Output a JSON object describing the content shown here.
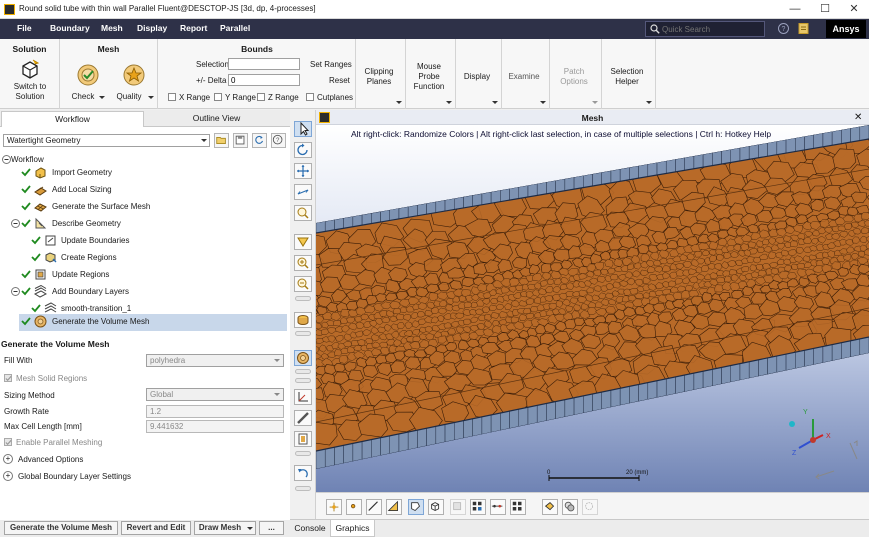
{
  "window": {
    "title": "Round solid tube with thin wall Parallel Fluent@DESCTOP-JS  [3d, dp, 4-processes]",
    "minimize": "—",
    "maximize": "☐",
    "close": "✕"
  },
  "menubar": {
    "items": [
      "File",
      "Boundary",
      "Mesh",
      "Display",
      "Report",
      "Parallel"
    ],
    "search_placeholder": "Quick Search",
    "brand": "Ansys"
  },
  "ribbon": {
    "solution": {
      "title": "Solution",
      "switch_label_1": "Switch to",
      "switch_label_2": "Solution"
    },
    "mesh": {
      "title": "Mesh",
      "check": "Check",
      "quality": "Quality"
    },
    "bounds": {
      "title": "Bounds",
      "selection_label": "Selection",
      "selection_value": "",
      "delta_label": "+/- Delta",
      "delta_value": "0",
      "set_ranges": "Set Ranges",
      "reset": "Reset",
      "x_range": "X Range",
      "y_range": "Y Range",
      "z_range": "Z Range",
      "cutplanes": "Cutplanes"
    },
    "clipping": {
      "l1": "Clipping",
      "l2": "Planes"
    },
    "probe": {
      "l1": "Mouse",
      "l2": "Probe",
      "l3": "Function"
    },
    "display": "Display",
    "examine": "Examine",
    "patch": {
      "l1": "Patch",
      "l2": "Options"
    },
    "selection": {
      "l1": "Selection",
      "l2": "Helper"
    }
  },
  "left_panel": {
    "tabs": [
      "Workflow",
      "Outline View"
    ],
    "workflow_type": "Watertight Geometry",
    "tree": {
      "root": "Workflow",
      "items": [
        {
          "label": "Import Geometry"
        },
        {
          "label": "Add Local Sizing"
        },
        {
          "label": "Generate the Surface Mesh"
        },
        {
          "label": "Describe Geometry"
        },
        {
          "label": "Update Boundaries"
        },
        {
          "label": "Create Regions"
        },
        {
          "label": "Update Regions"
        },
        {
          "label": "Add Boundary Layers"
        },
        {
          "label": "smooth-transition_1"
        },
        {
          "label": "Generate the Volume Mesh"
        }
      ]
    },
    "task": {
      "title": "Generate the Volume Mesh",
      "fill_with_label": "Fill With",
      "fill_with_value": "polyhedra",
      "mesh_solid_regions": "Mesh Solid Regions",
      "sizing_method_label": "Sizing Method",
      "sizing_method_value": "Global",
      "growth_rate_label": "Growth Rate",
      "growth_rate_value": "1.2",
      "max_cell_label": "Max Cell Length [mm]",
      "max_cell_value": "9.441632",
      "parallel_meshing": "Enable Parallel Meshing",
      "advanced": "Advanced Options",
      "global_bl": "Global Boundary Layer Settings"
    },
    "buttons": {
      "generate": "Generate the Volume Mesh",
      "revert": "Revert and Edit",
      "draw": "Draw Mesh",
      "more": "..."
    }
  },
  "graphics": {
    "title": "Mesh",
    "close": "✕",
    "hint": "Alt right-click: Randomize Colors | Alt right-click last selection, in case of multiple selections | Ctrl h: Hotkey Help",
    "scale_zero": "0",
    "scale_value": "20 (mm)",
    "axis_x": "X",
    "axis_y": "Y",
    "axis_z": "Z"
  },
  "bottom_tabs": [
    "Console",
    "Graphics"
  ],
  "colors": {
    "menubar": "#2e3148",
    "mesh_fill": "#b86a28",
    "mesh_edge": "#3a1d08",
    "wall": "#7e93b3",
    "background_top": "#ffffff",
    "background_bottom": "#6f83b4"
  }
}
